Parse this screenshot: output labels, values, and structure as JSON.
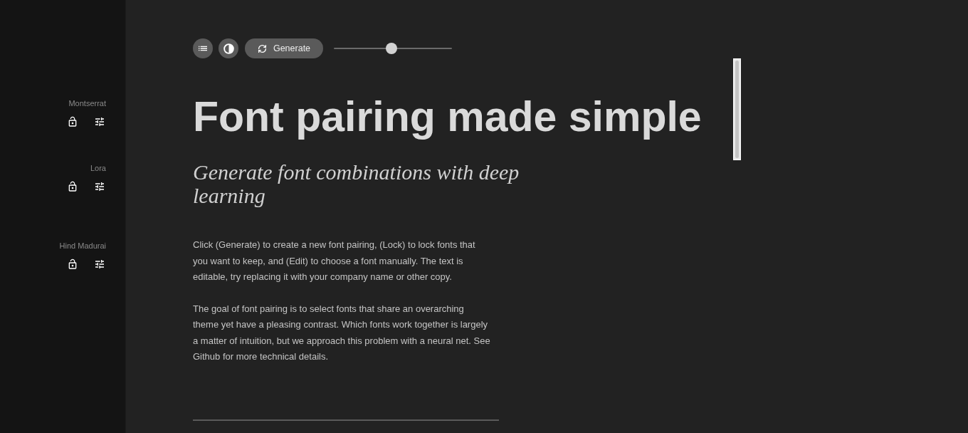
{
  "sidebar": {
    "fonts": [
      {
        "name": "Montserrat",
        "locked": false
      },
      {
        "name": "Lora",
        "locked": false
      },
      {
        "name": "Hind Madurai",
        "locked": false
      }
    ]
  },
  "toolbar": {
    "generate": "Generate",
    "slider": {
      "level": 0.49
    }
  },
  "heading": "Font pairing made simple",
  "subheading": "Generate font combinations with deep learning",
  "paragraphs": [
    "Click (Generate) to create a new font pairing, (Lock) to lock fonts that you want to keep, and (Edit) to choose a font manually. The text is editable, try replacing it with your company name or other copy.",
    "The goal of font pairing is to select fonts that share an overarching theme yet have a pleasing contrast. Which fonts work together is largely a matter of intuition, but we approach this problem with a neural net. See Github for more technical details."
  ]
}
